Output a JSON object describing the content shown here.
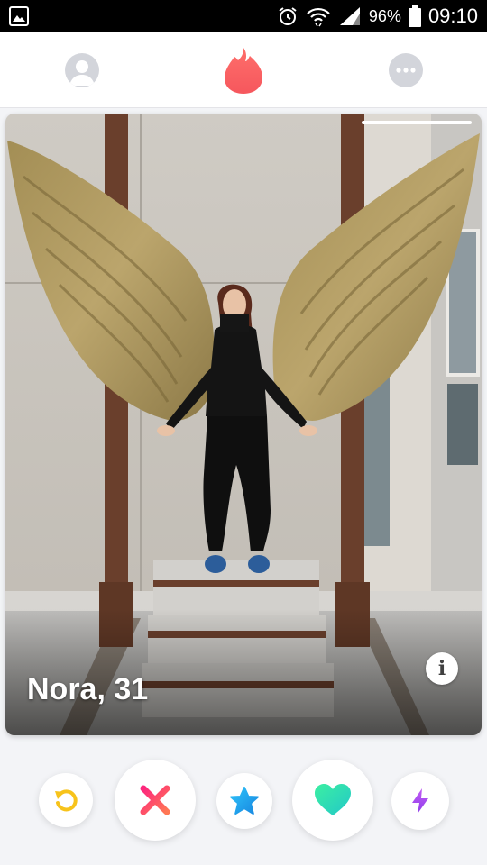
{
  "status_bar": {
    "battery_percent": "96%",
    "time": "09:10",
    "icons": [
      "gallery-icon",
      "alarm-icon",
      "wifi-icon",
      "signal-icon",
      "battery-icon"
    ]
  },
  "nav": {
    "left_icon": "profile-icon",
    "center_icon": "flame-logo-icon",
    "right_icon": "chat-icon",
    "accent_color": "#fd5564"
  },
  "card": {
    "name_age": "Nora, 31",
    "photo_index": 2,
    "photo_count": 4,
    "info_icon": "info-icon",
    "info_glyph": "i"
  },
  "actions": [
    {
      "name": "rewind",
      "icon": "rewind-icon",
      "color": "#f7c31b"
    },
    {
      "name": "nope",
      "icon": "close-icon",
      "color": "#fd4f6a"
    },
    {
      "name": "super-like",
      "icon": "star-icon",
      "color": "#1ea7f0"
    },
    {
      "name": "like",
      "icon": "heart-icon",
      "color": "#34d9b8"
    },
    {
      "name": "boost",
      "icon": "bolt-icon",
      "color": "#a54bf0"
    }
  ]
}
